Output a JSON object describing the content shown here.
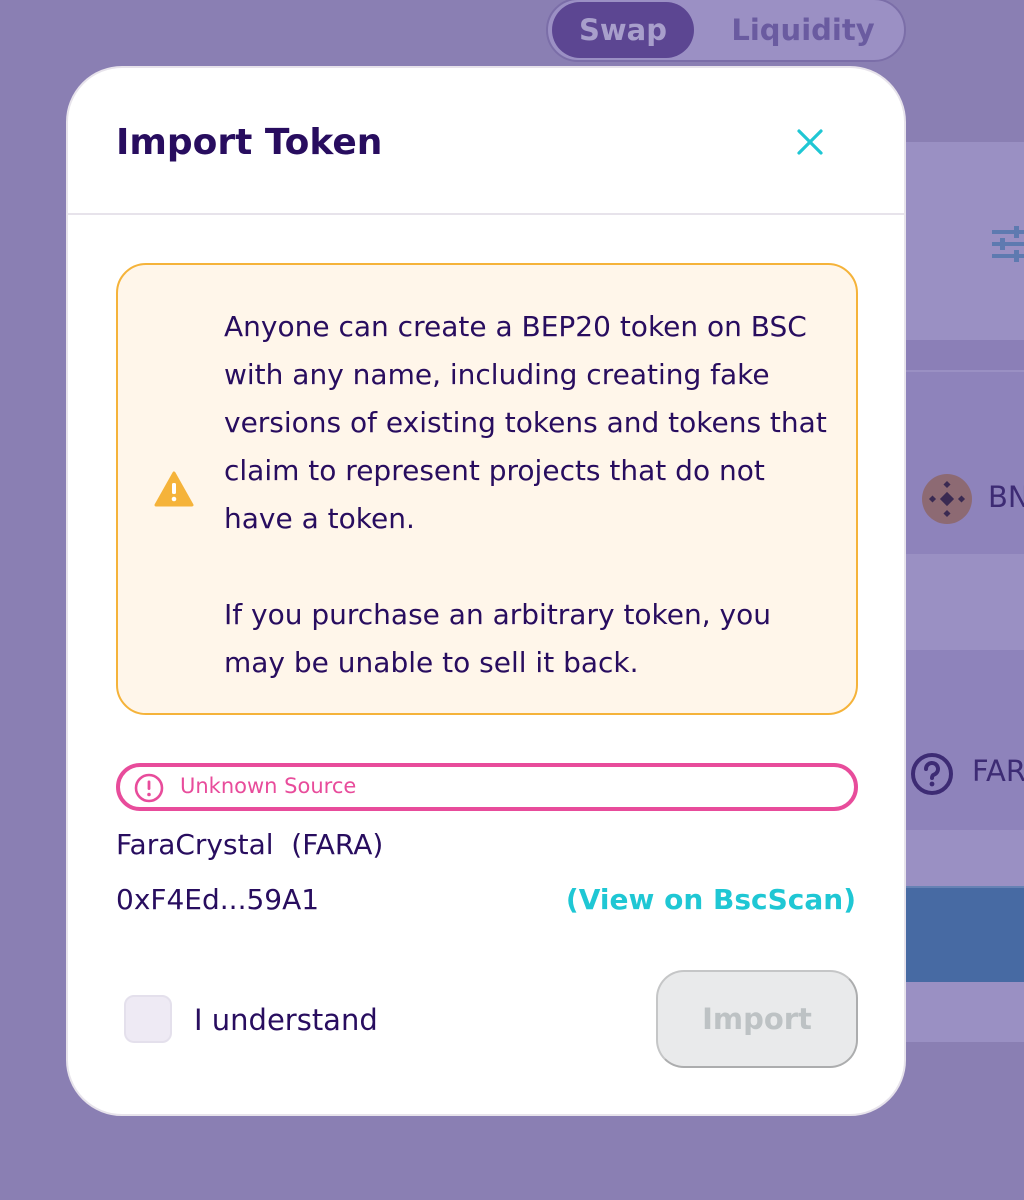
{
  "background": {
    "tabs": [
      {
        "label": "Swap",
        "active": true
      },
      {
        "label": "Liquidity",
        "active": false
      }
    ],
    "currency_a": "BN",
    "currency_b": "FAR"
  },
  "modal": {
    "title": "Import Token",
    "close_icon": "close-icon",
    "warning": {
      "icon": "warning-triangle-icon",
      "paragraph_1": "Anyone can create a BEP20 token on BSC with any name, including creating fake versions of existing tokens and tokens that claim to represent projects that do not have a token.",
      "paragraph_2": "If you purchase an arbitrary token, you may be unable to sell it back."
    },
    "source_badge": {
      "icon": "alert-circle-icon",
      "label": "Unknown Source"
    },
    "token": {
      "name_symbol": "FaraCrystal  (FARA)",
      "address": "0xF4Ed...59A1",
      "explorer_link": "(View on BscScan)"
    },
    "acknowledge": {
      "label": "I understand",
      "checked": false
    },
    "import_button": "Import"
  },
  "colors": {
    "primary_text": "#280d5f",
    "accent": "#1fc7d4",
    "warning": "#f5b33a",
    "failure": "#e84c9b",
    "overlay": "#8a7fb3"
  }
}
